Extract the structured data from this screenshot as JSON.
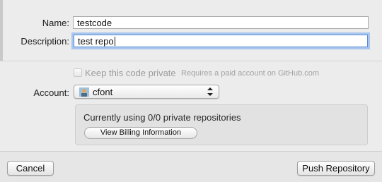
{
  "form": {
    "name_label": "Name:",
    "name_value": "testcode",
    "description_label": "Description:",
    "description_value": "test repo"
  },
  "private_option": {
    "label": "Keep this code private",
    "note": "Requires a paid account on GitHub.com",
    "checked": false,
    "enabled": false
  },
  "account": {
    "label": "Account:",
    "selected": "cfont"
  },
  "billing": {
    "status_text": "Currently using 0/0 private repositories",
    "button_label": "View Billing Information"
  },
  "footer": {
    "cancel_label": "Cancel",
    "push_label": "Push Repository"
  },
  "colors": {
    "focus_ring": "#a9c6ee",
    "background": "#ececec"
  }
}
